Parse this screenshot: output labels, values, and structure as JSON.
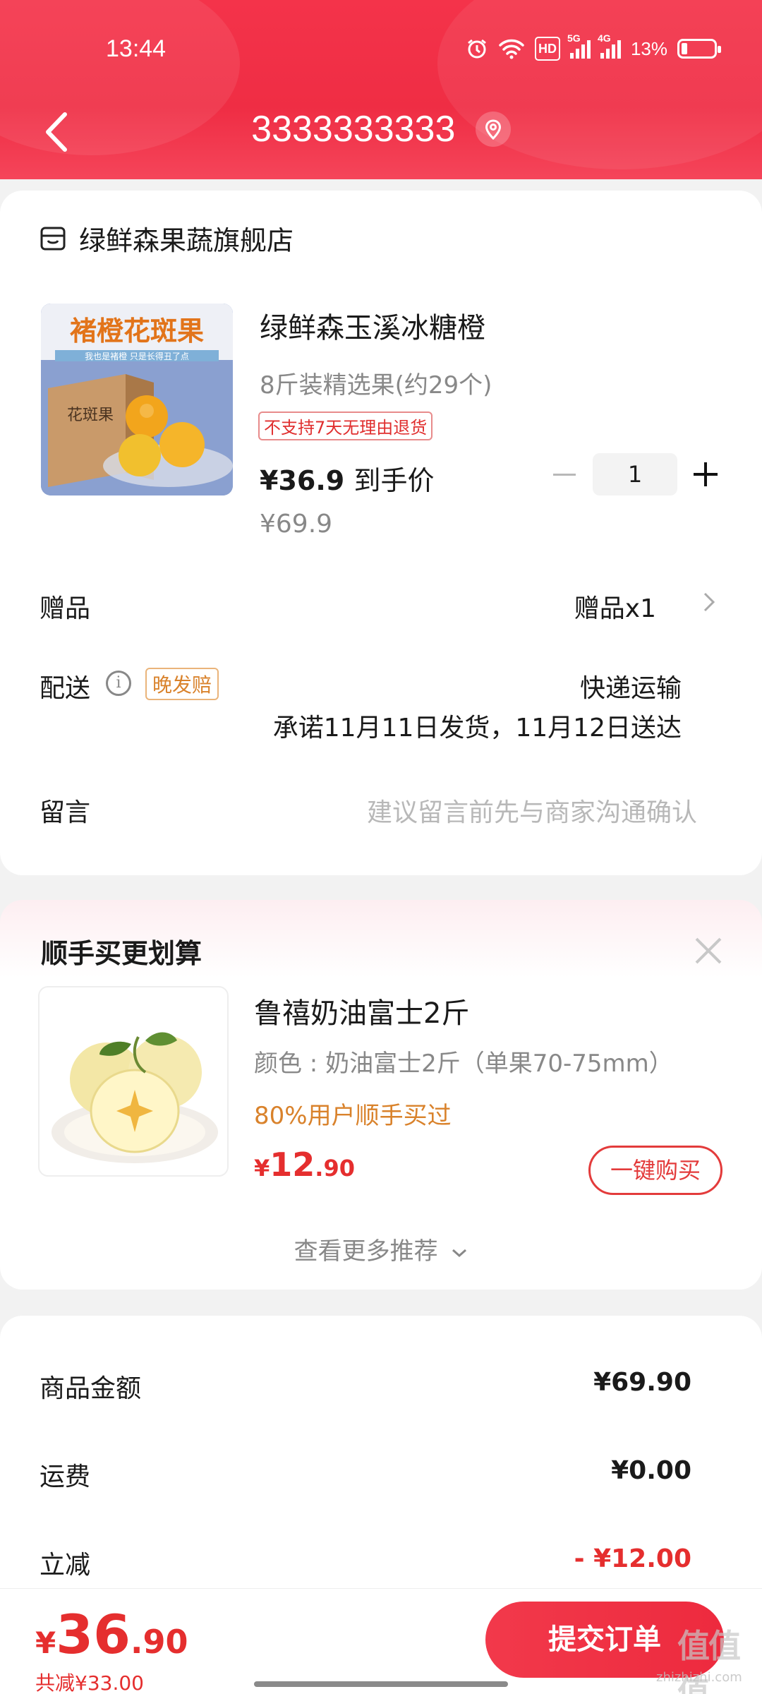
{
  "status": {
    "time": "13:44",
    "battery": "13%",
    "hd": "HD",
    "net1": "5G",
    "net2": "4G"
  },
  "nav": {
    "title": "3333333333"
  },
  "order": {
    "shop_name": "绿鲜森果蔬旗舰店",
    "product": {
      "image_text": "褚橙花斑果",
      "image_subtext": "我也是褚橙 只是长得丑了点",
      "box_text": "花斑果",
      "name": "绿鲜森玉溪冰糖橙",
      "spec": "8斤装精选果(约29个)",
      "tag": "不支持7天无理由退货",
      "price": "¥36.9",
      "price_suffix": "到手价",
      "original_price": "¥69.9",
      "quantity": "1"
    },
    "gift": {
      "label": "赠品",
      "value": "赠品x1"
    },
    "delivery": {
      "label": "配送",
      "badge": "晚发赔",
      "type": "快递运输",
      "promise": "承诺11月11日发货，11月12日送达"
    },
    "message": {
      "label": "留言",
      "placeholder": "建议留言前先与商家沟通确认"
    }
  },
  "recommend": {
    "title": "顺手买更划算",
    "item": {
      "name": "鲁禧奶油富士2斤",
      "spec": "颜色 : 奶油富士2斤（单果70-75mm）",
      "stat": "80%用户顺手买过",
      "price_currency": "¥",
      "price_int": "12",
      "price_dec": ".90",
      "buy_label": "一键购买"
    },
    "more_label": "查看更多推荐"
  },
  "summary": {
    "rows": [
      {
        "label": "商品金额",
        "value": "¥69.90"
      },
      {
        "label": "运费",
        "value": "¥0.00"
      },
      {
        "label": "立减",
        "value": "- ¥12.00"
      }
    ]
  },
  "footer": {
    "total_currency": "¥",
    "total_int": "36",
    "total_dec": ".90",
    "saved": "共减¥33.00",
    "submit_label": "提交订单",
    "watermark": "值值值",
    "watermark_sub": "zhizhizhi.com"
  },
  "colors": {
    "brand_red": "#ef2d44",
    "price_red": "#e52e2e",
    "accent_orange": "#d9822b"
  }
}
